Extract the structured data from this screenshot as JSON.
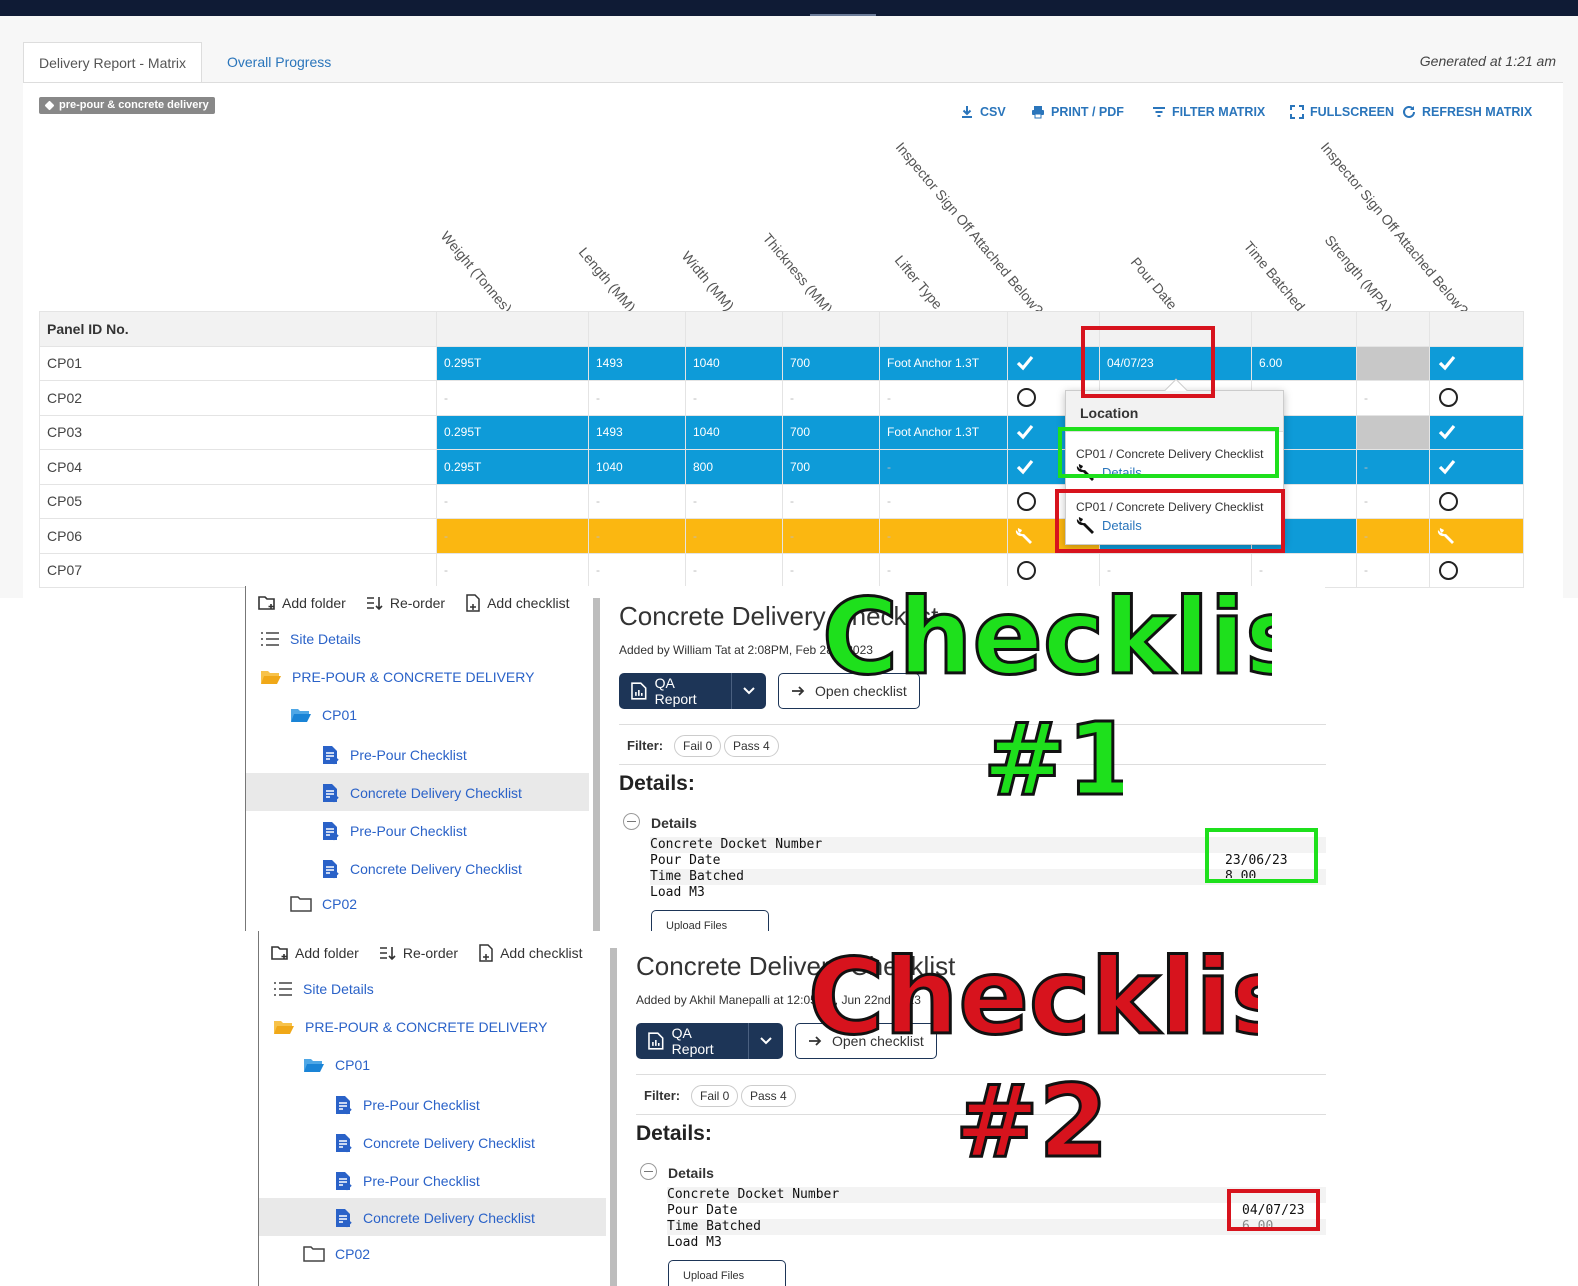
{
  "tabs": {
    "active": "Delivery Report - Matrix",
    "other": "Overall Progress"
  },
  "generated": "Generated at 1:21 am",
  "tag": "pre-pour & concrete delivery",
  "toolbar": {
    "csv": "CSV",
    "print": "PRINT / PDF",
    "filter": "FILTER MATRIX",
    "fullscreen": "FULLSCREEN",
    "refresh": "REFRESH MATRIX"
  },
  "columns": [
    "Weight (Tonnes)",
    "Length (MM)",
    "Width (MM)",
    "Thickness (MM)",
    "Lifter Type",
    "Inspector Sign Off Attached Below?",
    "Pour Date",
    "Time Batched",
    "Strength (MPA)",
    "Inspector Sign Off Attached Below?"
  ],
  "matrix": {
    "header": "Panel ID No.",
    "rows": [
      {
        "id": "CP01",
        "cells": [
          "0.295T",
          "1493",
          "1040",
          "700",
          "Foot Anchor 1.3T",
          "check",
          "04/07/23",
          "6.00",
          "grey",
          "check"
        ],
        "style": "blue"
      },
      {
        "id": "CP02",
        "cells": [
          "-",
          "-",
          "-",
          "-",
          "-",
          "circle",
          "",
          "",
          "-",
          "circle"
        ],
        "style": "white"
      },
      {
        "id": "CP03",
        "cells": [
          "0.295T",
          "1493",
          "1040",
          "700",
          "Foot Anchor 1.3T",
          "check",
          "",
          "",
          "grey",
          "check"
        ],
        "style": "blue"
      },
      {
        "id": "CP04",
        "cells": [
          "0.295T",
          "1040",
          "800",
          "700",
          "-",
          "check",
          "",
          "",
          "-",
          "check"
        ],
        "style": "blue"
      },
      {
        "id": "CP05",
        "cells": [
          "-",
          "-",
          "-",
          "-",
          "-",
          "circle",
          "",
          "",
          "-",
          "circle"
        ],
        "style": "white"
      },
      {
        "id": "CP06",
        "cells": [
          "-",
          "-",
          "-",
          "-",
          "-",
          "wrench",
          "",
          "",
          "-",
          "wrench"
        ],
        "style": "orange"
      },
      {
        "id": "CP07",
        "cells": [
          "-",
          "-",
          "-",
          "-",
          "-",
          "circle",
          "-",
          "-",
          "-",
          "circle"
        ],
        "style": "white"
      }
    ]
  },
  "popup": {
    "title": "Location",
    "items": [
      {
        "path": "CP01 / Concrete Delivery Checklist",
        "link": "Details"
      },
      {
        "path": "CP01 / Concrete Delivery Checklist",
        "link": "Details"
      }
    ]
  },
  "shot1": {
    "actions": {
      "add_folder": "Add folder",
      "reorder": "Re-order",
      "add_checklist": "Add checklist"
    },
    "tree": [
      "Site Details",
      "PRE-POUR & CONCRETE DELIVERY",
      "CP01",
      "Pre-Pour Checklist",
      "Concrete Delivery Checklist",
      "Pre-Pour Checklist",
      "Concrete Delivery Checklist",
      "CP02"
    ],
    "title": "Concrete Delivery Checklist",
    "added_by": "Added by William Tat at 2:08PM, Feb 28th 2023",
    "qa_report": "QA Report",
    "open_checklist": "Open checklist",
    "filter_label": "Filter:",
    "fail": "Fail 0",
    "pass": "Pass 4",
    "details_heading": "Details:",
    "details_section": "Details",
    "fields": [
      "Concrete Docket Number",
      "Pour Date",
      "Time Batched",
      "Load M3"
    ],
    "pour_date": "23/06/23",
    "time_batched": "8.00",
    "upload": "Upload Files",
    "overlay_word": "Checklist",
    "overlay_num": "#1"
  },
  "shot2": {
    "actions": {
      "add_folder": "Add folder",
      "reorder": "Re-order",
      "add_checklist": "Add checklist"
    },
    "tree": [
      "Site Details",
      "PRE-POUR & CONCRETE DELIVERY",
      "CP01",
      "Pre-Pour Checklist",
      "Concrete Delivery Checklist",
      "Pre-Pour Checklist",
      "Concrete Delivery Checklist",
      "CP02"
    ],
    "title": "Concrete Delivery Checklist",
    "added_by": "Added by Akhil Manepalli at 12:05PM, Jun 22nd 2023",
    "qa_report": "QA Report",
    "open_checklist": "Open checklist",
    "filter_label": "Filter:",
    "fail": "Fail 0",
    "pass": "Pass 4",
    "details_heading": "Details:",
    "details_section": "Details",
    "fields": [
      "Concrete Docket Number",
      "Pour Date",
      "Time Batched",
      "Load M3"
    ],
    "pour_date": "04/07/23",
    "time_batched": "6.00",
    "upload": "Upload Files",
    "overlay_word": "Checklist",
    "overlay_num": "#2"
  },
  "colors": {
    "blue": "#0e9bd8",
    "orange": "#fbb711",
    "nav": "#0f1b35",
    "link": "#2a75bb",
    "red": "#d7131d",
    "green": "#1ee01c"
  }
}
